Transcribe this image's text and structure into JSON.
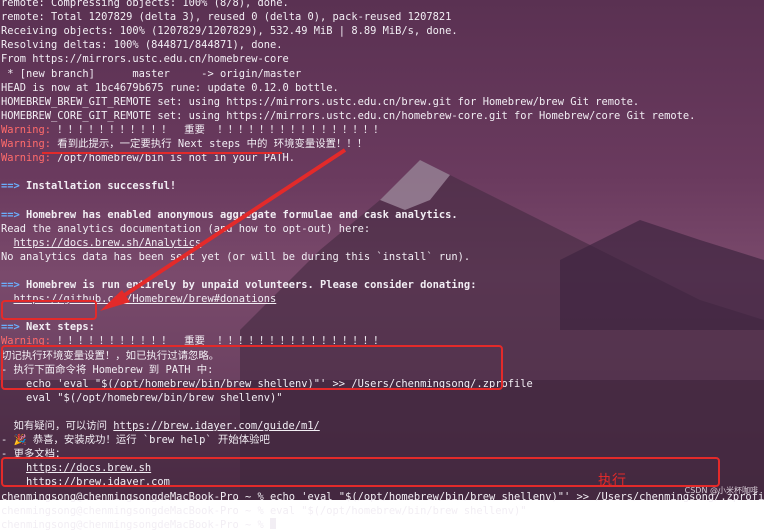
{
  "terminal": {
    "lines": [
      {
        "segs": [
          {
            "t": "remote: Compressing objects: 100% (8/8), done."
          }
        ]
      },
      {
        "segs": [
          {
            "t": "remote: Total 1207829 (delta 3), reused 0 (delta 0), pack-reused 1207821"
          }
        ]
      },
      {
        "segs": [
          {
            "t": "Receiving objects: 100% (1207829/1207829), 532.49 MiB | 8.89 MiB/s, done."
          }
        ]
      },
      {
        "segs": [
          {
            "t": "Resolving deltas: 100% (844871/844871), done."
          }
        ]
      },
      {
        "segs": [
          {
            "t": "From https://mirrors.ustc.edu.cn/homebrew-core"
          }
        ]
      },
      {
        "segs": [
          {
            "t": " * [new branch]      master     -> origin/master"
          }
        ]
      },
      {
        "segs": [
          {
            "t": "HEAD is now at 1bc4679b675 rune: update 0.12.0 bottle."
          }
        ]
      },
      {
        "segs": [
          {
            "t": "HOMEBREW_BREW_GIT_REMOTE set: using https://mirrors.ustc.edu.cn/brew.git for Homebrew/brew Git remote."
          }
        ]
      },
      {
        "segs": [
          {
            "t": "HOMEBREW_CORE_GIT_REMOTE set: using https://mirrors.ustc.edu.cn/homebrew-core.git for Homebrew/core Git remote."
          }
        ]
      },
      {
        "segs": [
          {
            "t": "Warning:",
            "c": "warn"
          },
          {
            "t": " ！！！！！！！！！！！  重要  ！！！！！！！！！！！！！！！！"
          }
        ]
      },
      {
        "segs": [
          {
            "t": "Warning:",
            "c": "warn"
          },
          {
            "t": " 看到此提示，一定要执行 Next steps 中的 环境变量设置！！！"
          }
        ]
      },
      {
        "segs": [
          {
            "t": "Warning:",
            "c": "warn"
          },
          {
            "t": " /opt/homebrew/bin is not in your PATH."
          }
        ]
      },
      {
        "segs": [
          {
            "t": ""
          }
        ]
      },
      {
        "segs": [
          {
            "t": "==>",
            "c": "arrow-p"
          },
          {
            "t": " Installation successful!",
            "c": "bold"
          }
        ]
      },
      {
        "segs": [
          {
            "t": ""
          }
        ]
      },
      {
        "segs": [
          {
            "t": "==>",
            "c": "arrow-p"
          },
          {
            "t": " Homebrew has enabled anonymous aggregate formulae and cask analytics.",
            "c": "bold"
          }
        ]
      },
      {
        "segs": [
          {
            "t": "Read the analytics documentation (and how to opt-out) here:"
          }
        ]
      },
      {
        "segs": [
          {
            "t": "  "
          },
          {
            "t": "https://docs.brew.sh/Analytics",
            "c": "link"
          }
        ]
      },
      {
        "segs": [
          {
            "t": "No analytics data has been sent yet (or will be during this `install` run)."
          }
        ]
      },
      {
        "segs": [
          {
            "t": ""
          }
        ]
      },
      {
        "segs": [
          {
            "t": "==>",
            "c": "arrow-p"
          },
          {
            "t": " Homebrew is run entirely by unpaid volunteers. Please consider donating:",
            "c": "bold"
          }
        ]
      },
      {
        "segs": [
          {
            "t": "  "
          },
          {
            "t": "https://github.com/Homebrew/brew#donations",
            "c": "link"
          }
        ]
      },
      {
        "segs": [
          {
            "t": ""
          }
        ]
      },
      {
        "segs": [
          {
            "t": "==>",
            "c": "arrow-p"
          },
          {
            "t": " Next steps:",
            "c": "bold"
          }
        ]
      },
      {
        "segs": [
          {
            "t": "Warning:",
            "c": "warn"
          },
          {
            "t": " ！！！！！！！！！！！  重要  ！！！！！！！！！！！！！！！！"
          }
        ]
      },
      {
        "segs": [
          {
            "t": "切记执行环境变量设置！，如已执行过请忽略。"
          }
        ]
      },
      {
        "segs": [
          {
            "t": "- 执行下面命令将 Homebrew 到 PATH 中:"
          }
        ]
      },
      {
        "segs": [
          {
            "t": "    echo 'eval \"$(/opt/homebrew/bin/brew shellenv)\"' >> /Users/chenmingsong/.zprofile"
          }
        ]
      },
      {
        "segs": [
          {
            "t": "    eval \"$(/opt/homebrew/bin/brew shellenv)\""
          }
        ]
      },
      {
        "segs": [
          {
            "t": ""
          }
        ]
      },
      {
        "segs": [
          {
            "t": "  如有疑问，可以访问 "
          },
          {
            "t": "https://brew.idayer.com/guide/m1/",
            "c": "link"
          }
        ]
      },
      {
        "segs": [
          {
            "t": "- 🎉 恭喜，安装成功！运行 `brew help` 开始体验吧"
          }
        ]
      },
      {
        "segs": [
          {
            "t": "- 更多文档："
          }
        ]
      },
      {
        "segs": [
          {
            "t": "    "
          },
          {
            "t": "https://docs.brew.sh",
            "c": "link"
          }
        ]
      },
      {
        "segs": [
          {
            "t": "    "
          },
          {
            "t": "https://brew.idayer.com",
            "c": "link"
          }
        ]
      },
      {
        "segs": [
          {
            "t": "chenmingsong@chenmingsongdeMacBook-Pro ~ % echo 'eval \"$(/opt/homebrew/bin/brew shellenv)\"' >> /Users/chenmingsong/.zprofile"
          }
        ]
      },
      {
        "segs": [
          {
            "t": "chenmingsong@chenmingsongdeMacBook-Pro ~ % eval \"$(/opt/homebrew/bin/brew shellenv)\""
          }
        ]
      },
      {
        "segs": [
          {
            "t": "chenmingsong@chenmingsongdeMacBook-Pro ~ % "
          }
        ]
      }
    ]
  },
  "annotation": {
    "label": "执行"
  },
  "watermark": "CSDN @小米杯咖啡",
  "colors": {
    "warning": "#ff6b6b",
    "prompt_arrow": "#6ab0ff",
    "annotation": "#e32a2a"
  }
}
